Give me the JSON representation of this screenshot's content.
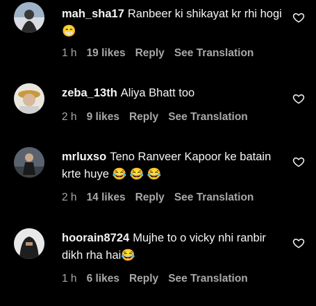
{
  "comments": [
    {
      "username": "mah_sha17",
      "text": "Ranbeer ki shikayat kr rhi hogi",
      "emoji": "😁",
      "time": "1 h",
      "likes": "19 likes",
      "reply": "Reply",
      "translate": "See Translation"
    },
    {
      "username": "zeba_13th",
      "text": "Aliya Bhatt too",
      "emoji": "",
      "time": "2 h",
      "likes": "9 likes",
      "reply": "Reply",
      "translate": "See Translation"
    },
    {
      "username": "mrluxso",
      "text": "Teno Ranveer Kapoor ke batain krte huye",
      "emoji": "😂 😂 😂",
      "time": "2 h",
      "likes": "14 likes",
      "reply": "Reply",
      "translate": "See Translation"
    },
    {
      "username": "hoorain8724",
      "text": "Mujhe to o vicky nhi ranbir dikh rha hai",
      "emoji": "😂",
      "time": "1 h",
      "likes": "6 likes",
      "reply": "Reply",
      "translate": "See Translation"
    }
  ],
  "icons": {
    "like": "heart-outline-icon"
  },
  "colors": {
    "background": "#000000",
    "text": "#f5f5f5",
    "meta": "#a8a8a8"
  }
}
